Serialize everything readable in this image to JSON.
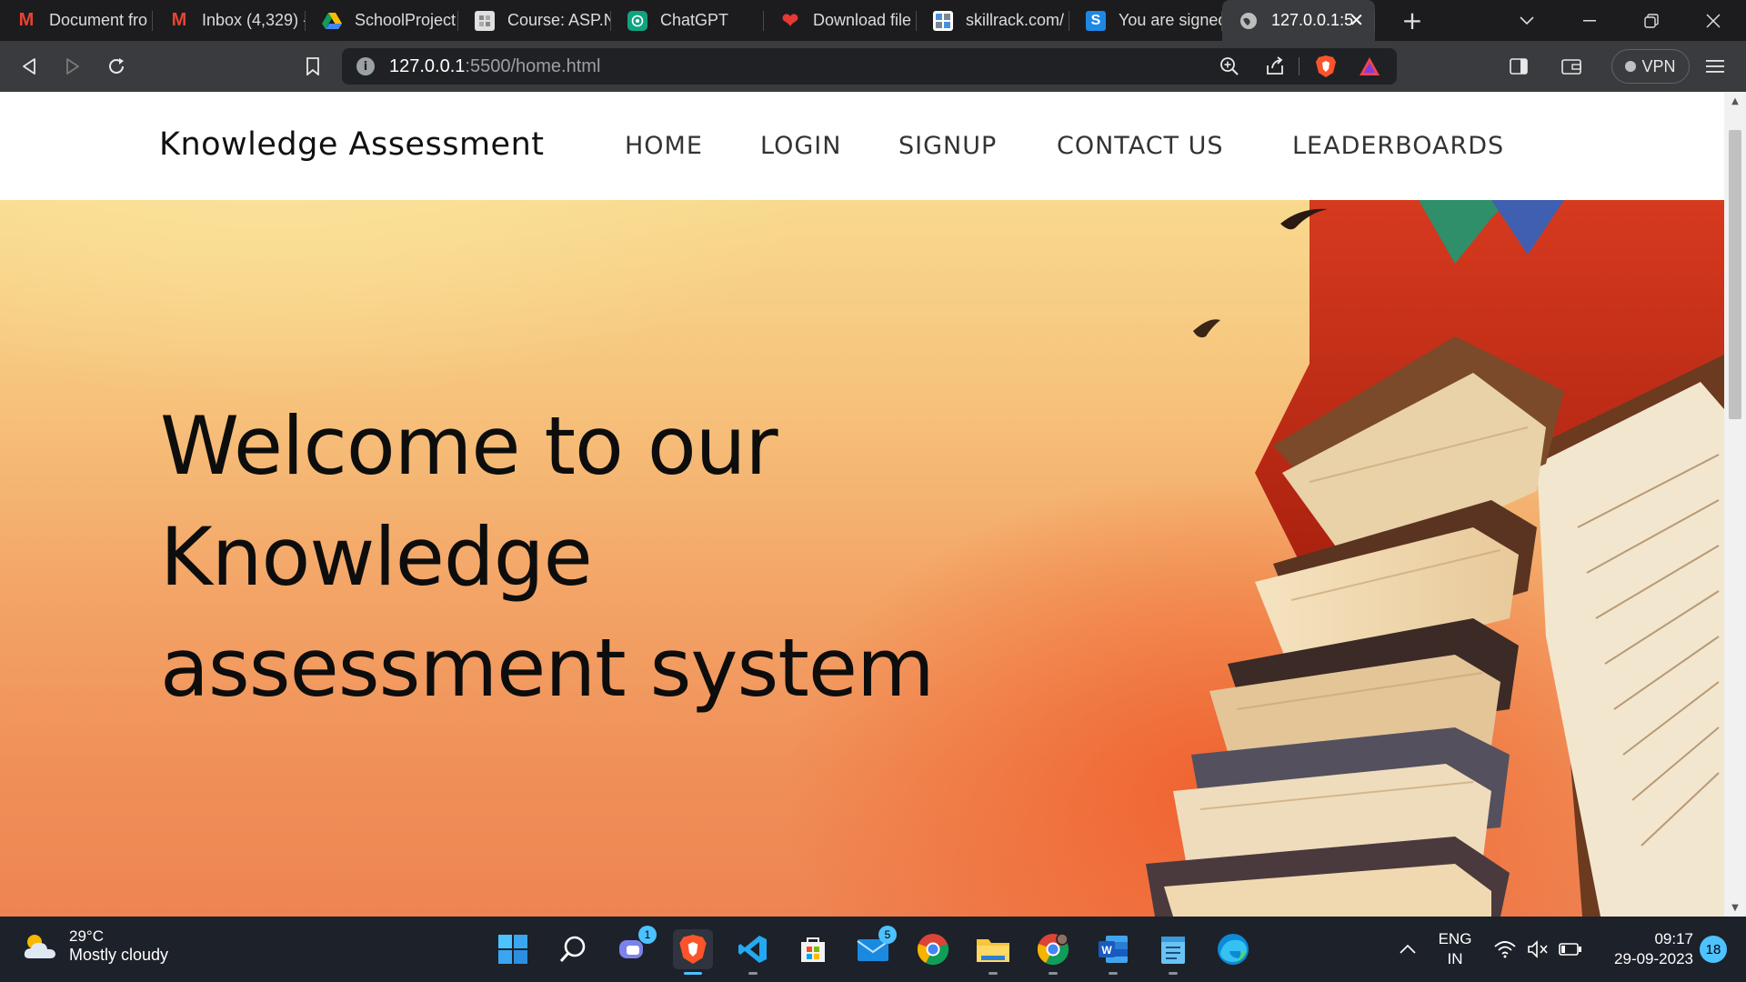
{
  "browser": {
    "tabs": [
      {
        "title": "Document fro",
        "icon": "gmail-icon",
        "color": "#ea4335"
      },
      {
        "title": "Inbox (4,329) -",
        "icon": "gmail-icon",
        "color": "#ea4335"
      },
      {
        "title": "SchoolProject",
        "icon": "google-drive-icon",
        "color": "#fbbc04"
      },
      {
        "title": "Course: ASP.N",
        "icon": "course-page-icon",
        "color": "#cfcfcf"
      },
      {
        "title": "ChatGPT",
        "icon": "chatgpt-icon",
        "color": "#10a37f"
      },
      {
        "title": "Download file",
        "icon": "heart-icon",
        "color": "#e53935"
      },
      {
        "title": "skillrack.com/",
        "icon": "skillrack-icon",
        "color": "#4a90e2"
      },
      {
        "title": "You are signed",
        "icon": "s-letter-icon",
        "color": "#1e88e5"
      },
      {
        "title": "127.0.0.1:5",
        "icon": "globe-icon",
        "color": "#bdbdbd",
        "active": true
      }
    ],
    "url_host": "127.0.0.1",
    "url_path": ":5500/home.html",
    "vpn_label": "VPN"
  },
  "site": {
    "brand": "Knowledge Assessment",
    "nav": [
      "HOME",
      "LOGIN",
      "SIGNUP",
      "CONTACT US",
      "LEADERBOARDS"
    ],
    "hero_title": "Welcome to our Knowledge assessment system"
  },
  "taskbar": {
    "weather_temp": "29°C",
    "weather_desc": "Mostly cloudy",
    "teams_badge": "1",
    "mail_badge": "5",
    "lang_top": "ENG",
    "lang_bottom": "IN",
    "time": "09:17",
    "date": "29-09-2023",
    "notifications": "18"
  }
}
